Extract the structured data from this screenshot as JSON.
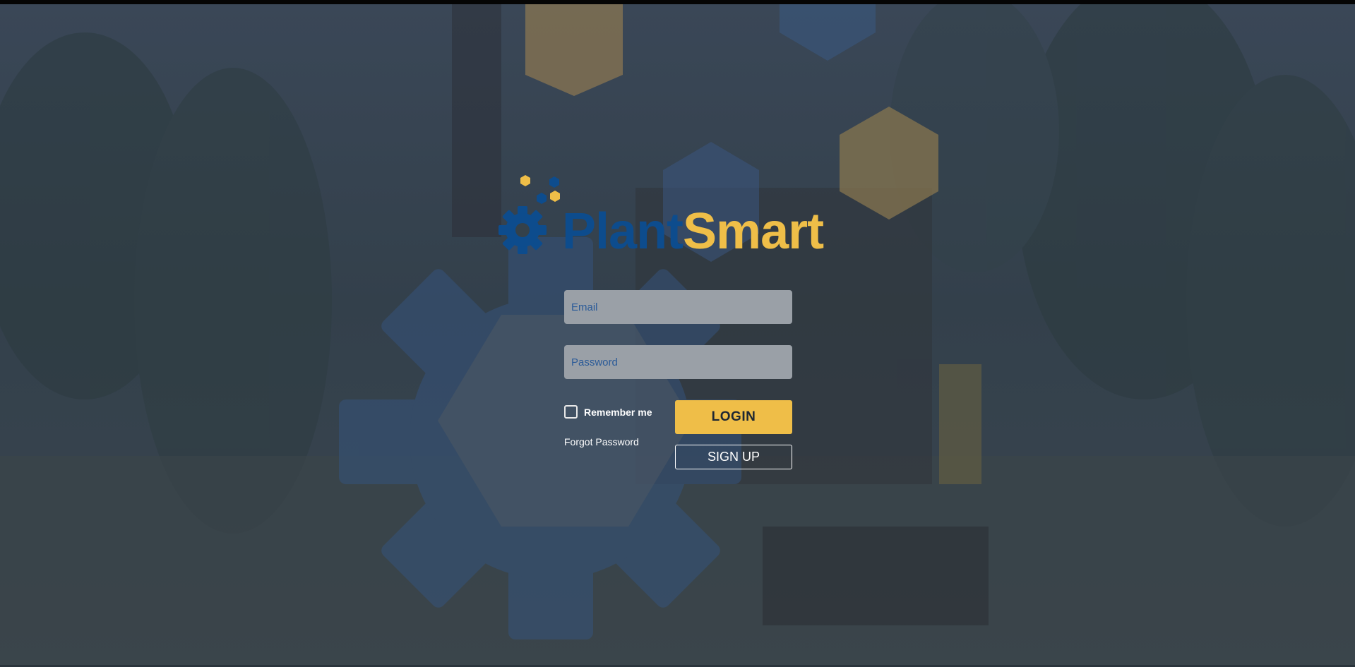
{
  "brand": {
    "name_part1": "Plant",
    "name_part2": "Smart",
    "color_blue": "#0d4c8d",
    "color_gold": "#efbe48"
  },
  "login": {
    "email_placeholder": "Email",
    "password_placeholder": "Password",
    "remember_label": "Remember me",
    "remember_checked": false,
    "forgot_label": "Forgot Password",
    "login_label": "LOGIN",
    "signup_label": "SIGN UP"
  },
  "icons": {
    "logo": "gear-icon",
    "checkbox": "checkbox-icon"
  }
}
